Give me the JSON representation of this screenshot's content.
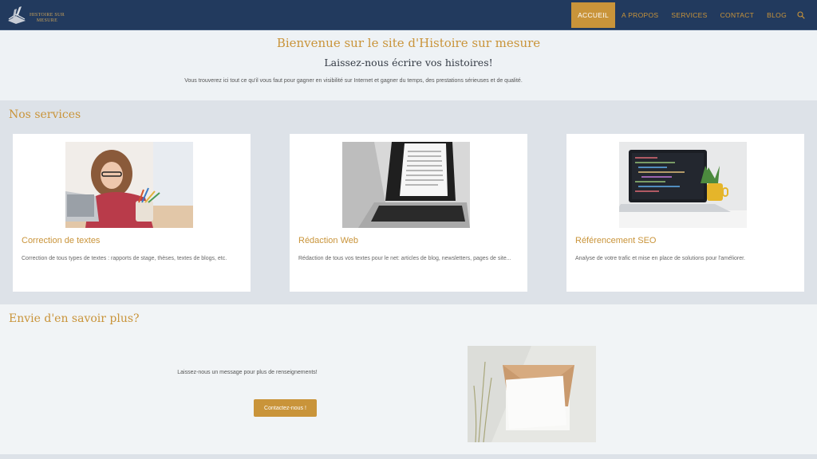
{
  "brand": {
    "logo_text_line1": "HISTOIRE SUR",
    "logo_text_line2": "MESURE",
    "accent": "#c9943a",
    "nav_bg": "#223a5e"
  },
  "nav": {
    "items": [
      {
        "label": "ACCUEIL",
        "active": true
      },
      {
        "label": "A PROPOS",
        "active": false
      },
      {
        "label": "SERVICES",
        "active": false
      },
      {
        "label": "CONTACT",
        "active": false
      },
      {
        "label": "BLOG",
        "active": false
      }
    ],
    "search_icon": "search-icon"
  },
  "hero": {
    "title": "Bienvenue sur le site d'Histoire sur mesure",
    "subtitle": "Laissez-nous écrire vos histoires!",
    "text": "Vous trouverez ici tout ce qu'il vous faut pour gagner en visibilité sur Internet et gagner du temps, des prestations sérieuses et de qualité."
  },
  "services": {
    "title": "Nos services",
    "cards": [
      {
        "title": "Correction de textes",
        "text": "Correction de tous types de textes : rapports de stage, thèses, textes de blogs, etc."
      },
      {
        "title": "Rédaction Web",
        "text": "Rédaction de tous vos textes pour le net: articles de blog, newsletters, pages de site..."
      },
      {
        "title": "Référencement SEO",
        "text": "Analyse de votre trafic et mise en place de solutions pour l'améliorer."
      }
    ]
  },
  "contact": {
    "title": "Envie d'en savoir plus?",
    "text": "Laissez-nous un message pour plus de renseignements!",
    "button": "Contactez-nous !"
  }
}
